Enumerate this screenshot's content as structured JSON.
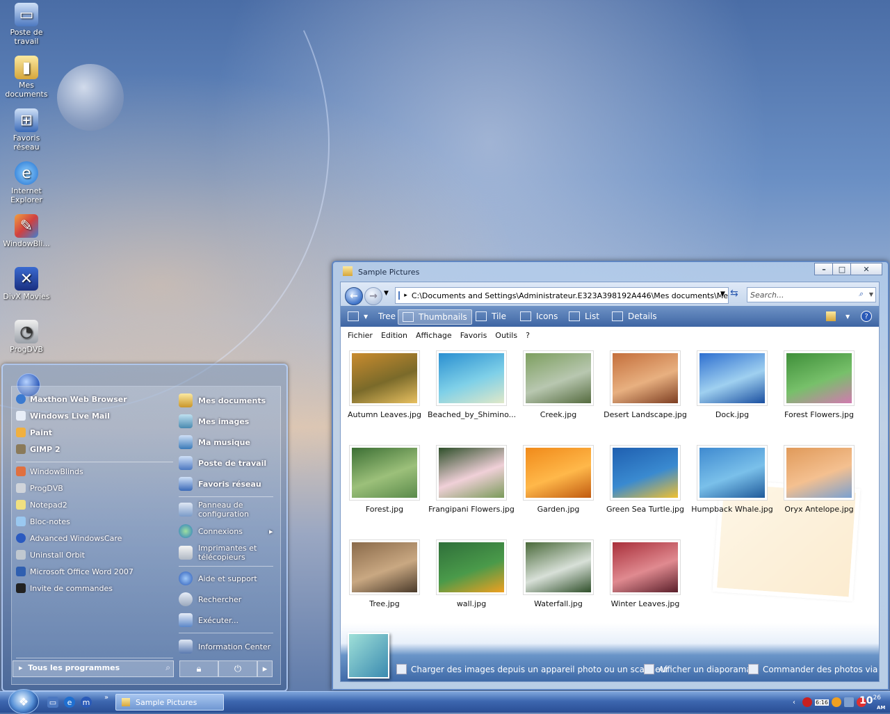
{
  "desktop": {
    "icons": [
      {
        "label": "Poste de travail",
        "icon": "computer-icon"
      },
      {
        "label": "Mes documents",
        "icon": "documents-folder-icon"
      },
      {
        "label": "Favoris réseau",
        "icon": "network-icon"
      },
      {
        "label": "Internet Explorer",
        "icon": "internet-explorer-icon"
      },
      {
        "label": "WindowBli...",
        "icon": "windowblinds-icon"
      },
      {
        "label": "DivX Movies",
        "icon": "divx-icon"
      },
      {
        "label": "ProgDVB",
        "icon": "satellite-dish-icon"
      }
    ]
  },
  "start_menu": {
    "pinned": [
      "Maxthon Web Browser",
      "Windows Live Mail",
      "Paint",
      "GIMP 2"
    ],
    "recent": [
      "WindowBlinds",
      "ProgDVB",
      "Notepad2",
      "Bloc-notes",
      "Advanced WindowsCare",
      "Uninstall Orbit",
      "Microsoft Office Word 2007",
      "Invite de commandes"
    ],
    "all_programs": "Tous les programmes",
    "right": [
      {
        "label": "Mes documents",
        "icon": "documents-icon"
      },
      {
        "label": "Mes images",
        "icon": "pictures-icon"
      },
      {
        "label": "Ma musique",
        "icon": "music-icon"
      },
      {
        "label": "Poste de travail",
        "icon": "computer-icon"
      },
      {
        "label": "Favoris réseau",
        "icon": "network-icon"
      },
      {
        "label": "Panneau de configuration",
        "icon": "control-panel-icon"
      },
      {
        "label": "Connexions",
        "icon": "connections-icon"
      },
      {
        "label": "Imprimantes et télécopieurs",
        "icon": "printer-icon"
      },
      {
        "label": "Aide et support",
        "icon": "help-icon"
      },
      {
        "label": "Rechercher",
        "icon": "search-icon"
      },
      {
        "label": "Exécuter...",
        "icon": "run-icon"
      },
      {
        "label": "Information Center",
        "icon": "information-icon"
      }
    ]
  },
  "explorer": {
    "title": "Sample Pictures",
    "address": "C:\\Documents and Settings\\Administrateur.E323A398192A446\\Mes documents\\Me",
    "search_placeholder": "Search...",
    "view_buttons": [
      "Tree",
      "Thumbnails",
      "Tile",
      "Icons",
      "List",
      "Details"
    ],
    "active_view": "Thumbnails",
    "menu": [
      "Fichier",
      "Edition",
      "Affichage",
      "Favoris",
      "Outils",
      "?"
    ],
    "files": [
      {
        "name": "Autumn Leaves.jpg",
        "colors": [
          "#c98b2e",
          "#7a6a2a",
          "#e8c060"
        ]
      },
      {
        "name": "Beached_by_Shimino...",
        "colors": [
          "#2a8fd1",
          "#7fd0e8",
          "#e0e8c8"
        ]
      },
      {
        "name": "Creek.jpg",
        "colors": [
          "#7d9f5f",
          "#b8c7b0",
          "#556b3f"
        ]
      },
      {
        "name": "Desert Landscape.jpg",
        "colors": [
          "#c46f3c",
          "#e8b080",
          "#7d3e22"
        ]
      },
      {
        "name": "Dock.jpg",
        "colors": [
          "#2e6fd0",
          "#9fd0f0",
          "#1a4fa0"
        ]
      },
      {
        "name": "Forest Flowers.jpg",
        "colors": [
          "#3f8f3a",
          "#77c06a",
          "#d27ab0"
        ]
      },
      {
        "name": "Forest.jpg",
        "colors": [
          "#3c6f34",
          "#9cc07a",
          "#5a8a4a"
        ]
      },
      {
        "name": "Frangipani Flowers.jpg",
        "colors": [
          "#2e4f2a",
          "#f0d0d8",
          "#7a9a5a"
        ]
      },
      {
        "name": "Garden.jpg",
        "colors": [
          "#f08a1a",
          "#ffb84a",
          "#c05a10"
        ]
      },
      {
        "name": "Green Sea Turtle.jpg",
        "colors": [
          "#1f5fb0",
          "#3a8ad0",
          "#f0c030"
        ]
      },
      {
        "name": "Humpback Whale.jpg",
        "colors": [
          "#3f8ad0",
          "#7ac0ea",
          "#1f5a9a"
        ]
      },
      {
        "name": "Oryx Antelope.jpg",
        "colors": [
          "#e09a5a",
          "#f4c090",
          "#7aa0d0"
        ]
      },
      {
        "name": "Tree.jpg",
        "colors": [
          "#8a6a4a",
          "#c9a882",
          "#4a3a2a"
        ]
      },
      {
        "name": "wall.jpg",
        "colors": [
          "#2f6f3a",
          "#4a9a4a",
          "#f0a020"
        ]
      },
      {
        "name": "Waterfall.jpg",
        "colors": [
          "#4a6a3a",
          "#d8e0d8",
          "#2f4f2a"
        ]
      },
      {
        "name": "Winter Leaves.jpg",
        "colors": [
          "#a82f3a",
          "#e08a90",
          "#5a1f2a"
        ]
      }
    ],
    "tasks": [
      {
        "label": "Charger des images depuis un appareil photo ou un scanneur",
        "icon": "camera-icon"
      },
      {
        "label": "Afficher un diaporama",
        "icon": "slideshow-icon"
      },
      {
        "label": "Commander des photos via",
        "icon": "order-photos-icon"
      }
    ]
  },
  "taskbar": {
    "task_label": "Sample Pictures",
    "clock_time": "10",
    "clock_minutes": "26",
    "clock_ampm": "AM",
    "tray_label": "6:16"
  }
}
